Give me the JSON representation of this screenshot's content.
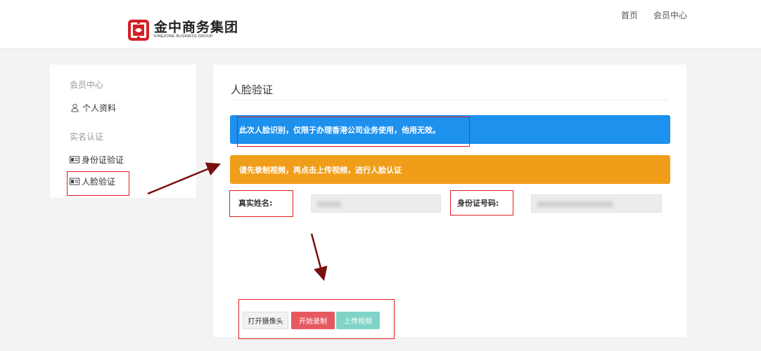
{
  "header": {
    "logo_cn": "金中商务集团",
    "logo_en": "KINEZONE BUSINESS GROUP",
    "nav": {
      "home": "首页",
      "member": "会员中心"
    }
  },
  "sidebar": {
    "group1": "会员中心",
    "profile": "个人资料",
    "group2": "实名认证",
    "id_verify": "身份证验证",
    "face_verify": "人脸验证"
  },
  "main": {
    "title": "人脸验证",
    "notice_blue": "此次人脸识别，仅限于办理香港公司业务使用，他用无效。",
    "notice_orange": "请先录制视频，再点击上传视频，进行人脸认证",
    "name_label": "真实姓名:",
    "id_label": "身份证号码:",
    "btn_camera": "打开摄像头",
    "btn_record": "开始录制",
    "btn_upload": "上传视频"
  },
  "colors": {
    "blue": "#1e90ee",
    "orange": "#f09e1a",
    "record": "#e55a61",
    "upload": "#7fd4c7",
    "annotation": "#e11d1d",
    "arrow": "#7a0f0f"
  }
}
